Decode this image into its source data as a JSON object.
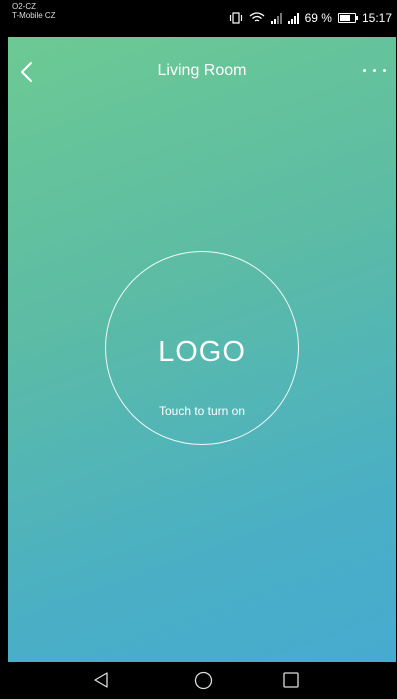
{
  "status": {
    "carrier_line1": "O2-CZ",
    "carrier_line2": "T-Mobile CZ",
    "battery_percent": "69 %",
    "battery_level": 0.69,
    "time": "15:17"
  },
  "header": {
    "title": "Living Room",
    "back_icon": "chevron-left-icon",
    "more_icon": "more-horizontal-icon"
  },
  "main": {
    "logo": "LOGO",
    "hint": "Touch to turn on"
  },
  "navigation": {
    "back_icon": "triangle-back-icon",
    "home_icon": "circle-home-icon",
    "recent_icon": "square-recents-icon"
  },
  "colors": {
    "gradient_start": "#6fcb91",
    "gradient_end": "#45aad2"
  }
}
